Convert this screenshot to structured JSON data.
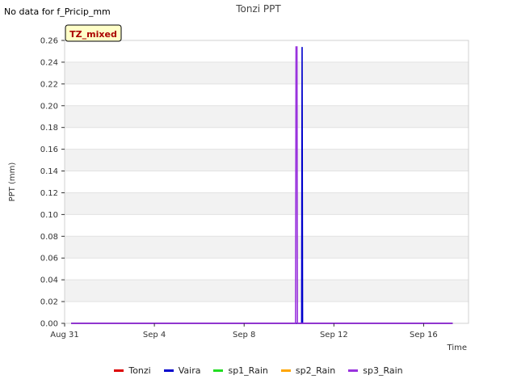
{
  "notice": "No data for f_Pricip_mm",
  "chart_data": {
    "type": "line",
    "title": "Tonzi PPT",
    "xlabel": "Time",
    "ylabel": "PPT (mm)",
    "site_badge": "TZ_mixed",
    "x_range": [
      "2024-08-31",
      "2024-09-18"
    ],
    "x_ticks": [
      {
        "date": "2024-08-31",
        "label": "Aug 31"
      },
      {
        "date": "2024-09-04",
        "label": "Sep 4"
      },
      {
        "date": "2024-09-08",
        "label": "Sep 8"
      },
      {
        "date": "2024-09-12",
        "label": "Sep 12"
      },
      {
        "date": "2024-09-16",
        "label": "Sep 16"
      }
    ],
    "ylim": [
      0,
      0.26
    ],
    "y_ticks": [
      0.0,
      0.02,
      0.04,
      0.06,
      0.08,
      0.1,
      0.12,
      0.14,
      0.16,
      0.18,
      0.2,
      0.22,
      0.24,
      0.26
    ],
    "grid": "horizontal alternating bands",
    "legend_position": "bottom-center",
    "series": [
      {
        "name": "Tonzi",
        "color": "#dd0000",
        "points": [
          [
            "2024-08-31T07:00",
            0
          ],
          [
            "2024-09-17T07:00",
            0
          ]
        ]
      },
      {
        "name": "Vaira",
        "color": "#0000cc",
        "points": [
          [
            "2024-08-31T07:00",
            0
          ],
          [
            "2024-09-10T13:30",
            0
          ],
          [
            "2024-09-10T14:00",
            0.254
          ],
          [
            "2024-09-10T14:30",
            0
          ],
          [
            "2024-09-17T07:00",
            0
          ]
        ]
      },
      {
        "name": "sp1_Rain",
        "color": "#22dd22",
        "points": []
      },
      {
        "name": "sp2_Rain",
        "color": "#ffa500",
        "points": []
      },
      {
        "name": "sp3_Rain",
        "color": "#9933dd",
        "points": [
          [
            "2024-08-31T07:00",
            0
          ],
          [
            "2024-09-10T07:00",
            0
          ],
          [
            "2024-09-10T07:30",
            0.254
          ],
          [
            "2024-09-10T08:30",
            0.254
          ],
          [
            "2024-09-10T09:00",
            0
          ],
          [
            "2024-09-17T07:00",
            0
          ]
        ]
      }
    ]
  }
}
